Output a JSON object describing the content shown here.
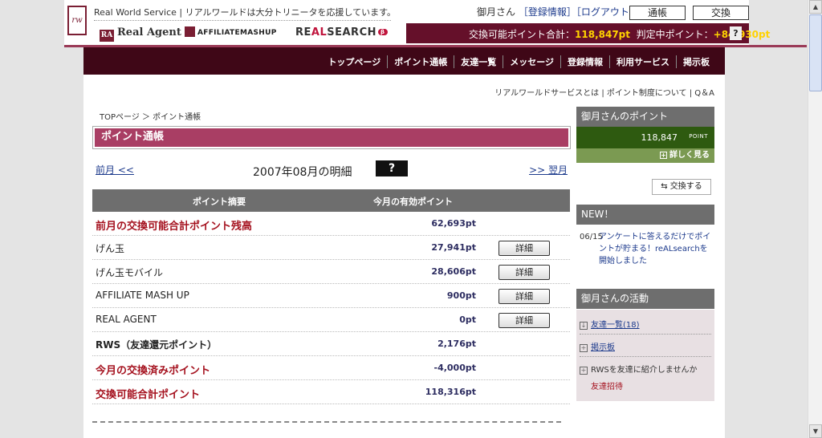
{
  "header": {
    "service_text": "Real World Service | リアルワールドは大分トリニータを応援しています。",
    "logo_text": "rw",
    "brands": {
      "real_agent": "Real Agent",
      "real_agent_mark": "RA",
      "affiliate": "AFFILIATEMASHUP",
      "realsearch_pre": "RE",
      "realsearch_al": "AL",
      "realsearch_post": "SEARCH",
      "realsearch_beta": "β"
    },
    "user_name": "御月さん",
    "register_info": "［登録情報］",
    "logout": "［ログアウト］",
    "btn_passbook": "通帳",
    "btn_exchange": "交換",
    "points_label": "交換可能ポイント合計：",
    "points_value": "118,847pt",
    "judging_label": "判定中ポイント：",
    "judging_value": "+84,930pt",
    "help": "?"
  },
  "nav": {
    "items": [
      "トップページ",
      "ポイント通帳",
      "友達一覧",
      "メッセージ",
      "登録情報",
      "利用サービス",
      "掲示板"
    ]
  },
  "sublinks": "リアルワールドサービスとは | ポイント制度について | Q＆A",
  "breadcrumb": "TOPページ ＞ ポイント通帳",
  "page_title": "ポイント通帳",
  "month_nav": {
    "prev": "前月 <<",
    "title": "2007年08月の明細",
    "help": "?",
    "next": ">> 翌月"
  },
  "table": {
    "col1": "ポイント摘要",
    "col2": "今月の有効ポイント",
    "detail_label": "詳細",
    "rows": [
      {
        "label": "前月の交換可能合計ポイント残高",
        "value": "62,693pt"
      },
      {
        "label": "げん玉",
        "value": "27,941pt"
      },
      {
        "label": "げん玉モバイル",
        "value": "28,606pt"
      },
      {
        "label": "AFFILIATE MASH UP",
        "value": "900pt"
      },
      {
        "label": "REAL AGENT",
        "value": "0pt"
      },
      {
        "label": "RWS（友達還元ポイント）",
        "value": "2,176pt"
      },
      {
        "label": "今月の交換済みポイント",
        "value": "-4,000pt"
      },
      {
        "label": "交換可能合計ポイント",
        "value": "118,316pt"
      }
    ]
  },
  "sidebar": {
    "points_head": "御月さんのポイント",
    "points_value": "118,847",
    "points_unit": "POINT",
    "more": "詳しく見る",
    "exchange_btn": "交換する",
    "new_head": "NEW！",
    "news_date": "06/15",
    "news_text": "アンケートに答えるだけでポイントが貯まる！reALsearchを開始しました",
    "activity_head": "御月さんの活動",
    "activity": [
      "友達一覧(18)",
      "掲示板",
      "RWSを友達に紹介しませんか",
      "友達招待"
    ]
  },
  "colors": {
    "brand": "#65102a",
    "title": "#a93e64",
    "highlight": "#ffd200",
    "green": "#2e5a10"
  }
}
